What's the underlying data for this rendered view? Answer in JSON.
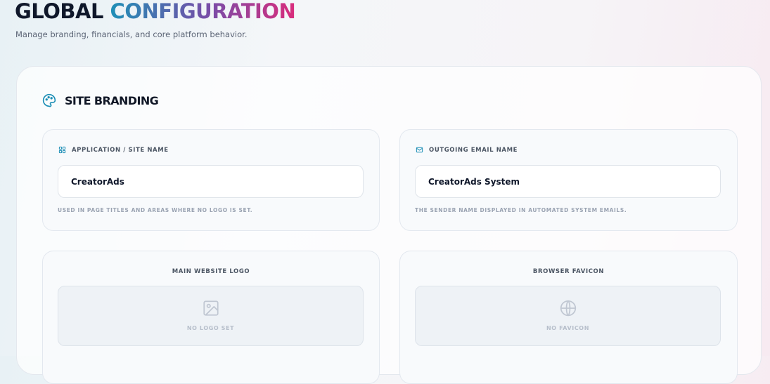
{
  "header": {
    "title_part1": "GLOBAL",
    "title_part2": "CONFIGURATION",
    "subtitle": "Manage branding, financials, and core platform behavior."
  },
  "colors": {
    "accent_teal": "#1e8fb6",
    "accent_pink": "#d92c7c",
    "accent_purple": "#7b4ba7"
  },
  "section": {
    "icon": "palette-icon",
    "title": "SITE BRANDING"
  },
  "site_name": {
    "icon": "grid-icon",
    "label": "APPLICATION / SITE NAME",
    "value": "CreatorAds",
    "hint": "USED IN PAGE TITLES AND AREAS WHERE NO LOGO IS SET."
  },
  "email_name": {
    "icon": "mail-icon",
    "label": "OUTGOING EMAIL NAME",
    "value": "CreatorAds System",
    "hint": "THE SENDER NAME DISPLAYED IN AUTOMATED SYSTEM EMAILS."
  },
  "logo": {
    "title": "MAIN WEBSITE LOGO",
    "icon": "image-icon",
    "empty_text": "NO LOGO SET"
  },
  "favicon": {
    "title": "BROWSER FAVICON",
    "icon": "globe-icon",
    "empty_text": "NO FAVICON"
  }
}
